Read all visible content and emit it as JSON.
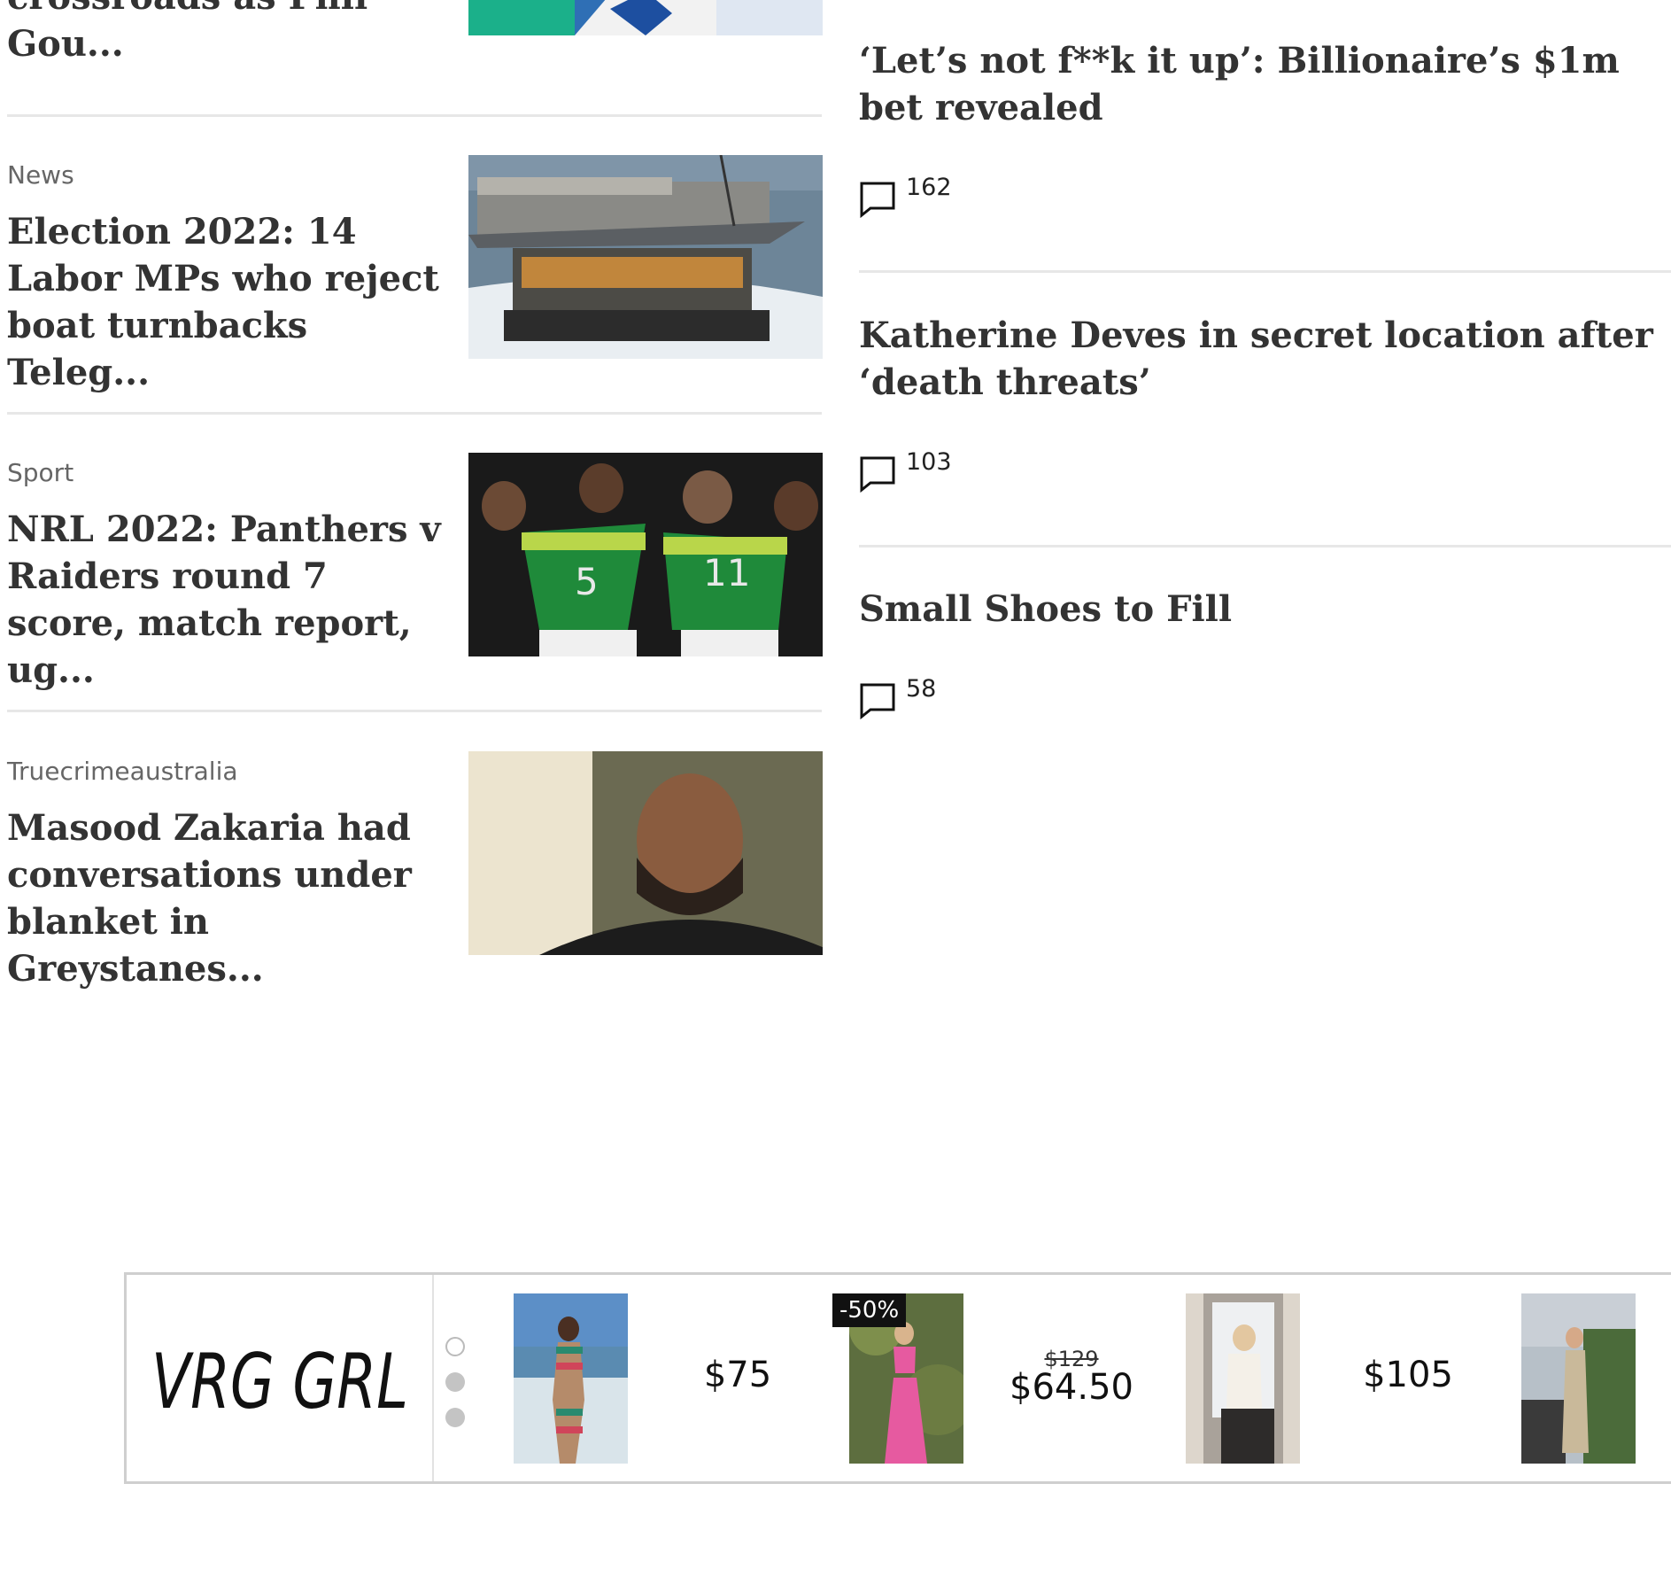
{
  "left_articles": [
    {
      "category": "",
      "headline": "crossroads as Phil Gou..."
    },
    {
      "category": "News",
      "headline": "Election 2022: 14 Labor MPs who reject boat turnbacks Teleg..."
    },
    {
      "category": "Sport",
      "headline": "NRL 2022: Panthers v Raiders round 7 score, match report, ug..."
    },
    {
      "category": "Truecrimeaustralia",
      "headline": "Masood Zakaria had conversations under blanket in Greystanes..."
    }
  ],
  "right_articles": [
    {
      "headline": "‘Let’s not f**k it up’: Billionaire’s $1m bet revealed",
      "comments": "162"
    },
    {
      "headline": "Katherine Deves in secret location after ‘death threats’",
      "comments": "103"
    },
    {
      "headline": "Small Shoes to Fill",
      "comments": "58"
    }
  ],
  "ad": {
    "brand": "VRG GRL",
    "products": [
      {
        "price": "$75",
        "old_price": "",
        "discount": ""
      },
      {
        "price": "$64.50",
        "old_price": "$129",
        "discount": "-50%"
      },
      {
        "price": "$105",
        "old_price": "",
        "discount": ""
      },
      {
        "price": "",
        "old_price": "",
        "discount": ""
      }
    ]
  },
  "colors": {
    "divider": "#e7e7e7",
    "text": "#333333",
    "category": "#666666"
  },
  "icons": [
    "comment-icon"
  ]
}
